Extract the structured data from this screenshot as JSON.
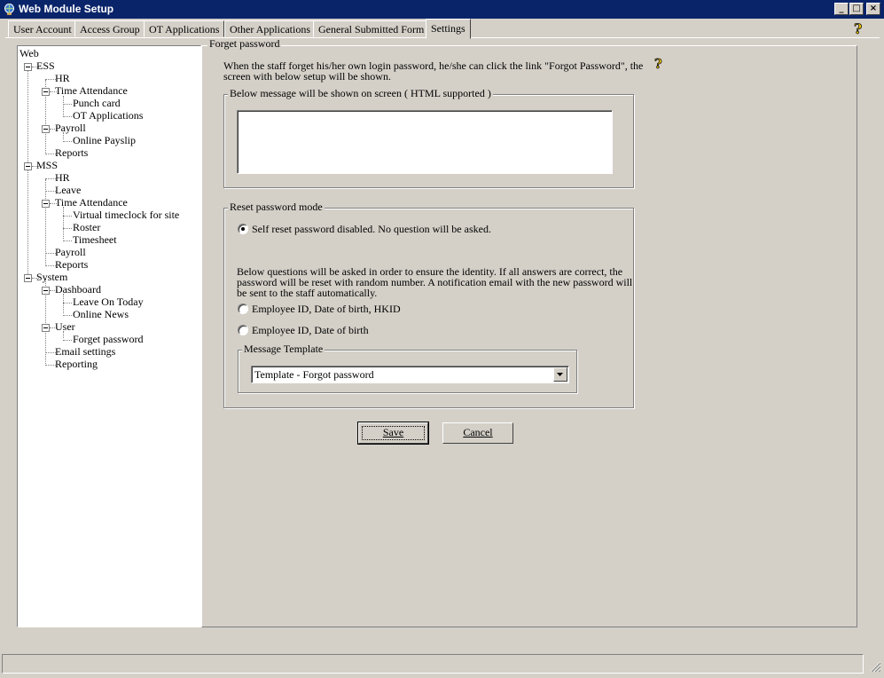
{
  "window": {
    "title": "Web Module Setup",
    "controls": {
      "minimize": "_",
      "maximize": "□",
      "close": "×"
    }
  },
  "tabs": [
    {
      "label": "User Account"
    },
    {
      "label": "Access Group"
    },
    {
      "label": "OT Applications"
    },
    {
      "label": "Other Applications"
    },
    {
      "label": "General Submitted Form"
    },
    {
      "label": "Settings",
      "active": true
    }
  ],
  "tree": {
    "root": "Web",
    "ess": {
      "label": "ESS",
      "hr": "HR",
      "time_attendance": {
        "label": "Time Attendance",
        "punch_card": "Punch card",
        "ot_applications": "OT Applications"
      },
      "payroll": {
        "label": "Payroll",
        "online_payslip": "Online Payslip"
      },
      "reports": "Reports"
    },
    "mss": {
      "label": "MSS",
      "hr": "HR",
      "leave": "Leave",
      "time_attendance": {
        "label": "Time Attendance",
        "virtual_timeclock": "Virtual timeclock for site",
        "roster": "Roster",
        "timesheet": "Timesheet"
      },
      "payroll": "Payroll",
      "reports": "Reports"
    },
    "system": {
      "label": "System",
      "dashboard": {
        "label": "Dashboard",
        "leave_on_today": "Leave On Today",
        "online_news": "Online News"
      },
      "user": {
        "label": "User",
        "forget_password": "Forget password"
      },
      "email_settings": "Email settings",
      "reporting": "Reporting"
    }
  },
  "forget_password": {
    "group_title": "Forget password",
    "description_line1": "When the staff forget his/her own login password, he/she can click the link \"Forgot Password\", the",
    "description_line2": "screen with below setup will be shown.",
    "message_group_title": "Below message will be shown on screen ( HTML supported )",
    "message_value": ""
  },
  "reset_mode": {
    "group_title": "Reset password mode",
    "option_disabled": "Self reset password disabled. No question will be asked.",
    "selected": "disabled",
    "explanation_line1": "Below questions will be asked in order to ensure the identity. If all answers are correct, the",
    "explanation_line2": "password will be reset with random number. A notification email with the new password will",
    "explanation_line3": "be sent to the staff automatically.",
    "option_id_dob_hkid": "Employee ID, Date of birth, HKID",
    "option_id_dob": "Employee ID, Date of birth",
    "template_group_title": "Message Template",
    "template_selected": "Template - Forgot password"
  },
  "buttons": {
    "save": "Save",
    "cancel": "Cancel"
  },
  "status_bar": {
    "text": ""
  }
}
